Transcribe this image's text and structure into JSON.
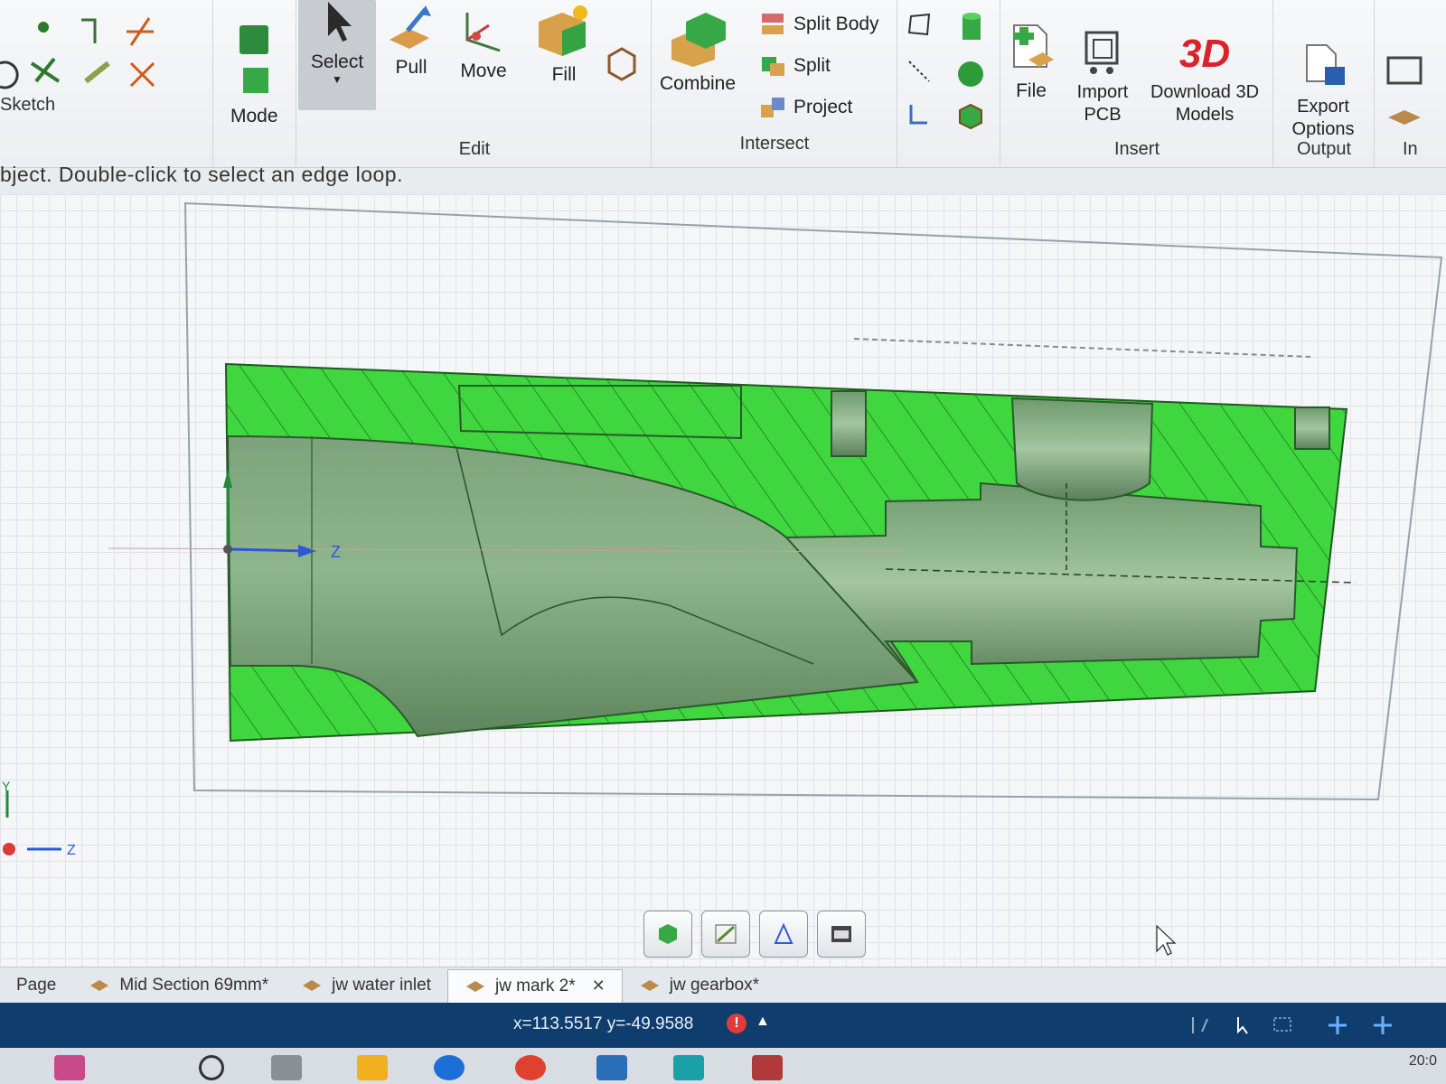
{
  "ribbon": {
    "sketch_label": "Sketch",
    "mode_label": "Mode",
    "edit": {
      "group_label": "Edit",
      "select_label": "Select",
      "pull_label": "Pull",
      "move_label": "Move",
      "fill_label": "Fill"
    },
    "intersect": {
      "group_label": "Intersect",
      "combine_label": "Combine",
      "split_body_label": "Split Body",
      "split_label": "Split",
      "project_label": "Project"
    },
    "insert": {
      "group_label": "Insert",
      "file_label": "File",
      "import_pcb_label": "Import PCB",
      "download_label": "Download 3D Models",
      "download_badge": "3D"
    },
    "output": {
      "group_label": "Output",
      "export_label": "Export Options"
    },
    "next_group_label": "In"
  },
  "hint_text": "bject. Double-click to select an edge loop.",
  "axis": {
    "z": "Z",
    "y": "Y"
  },
  "tabs": [
    {
      "label": "Page"
    },
    {
      "label": "Mid Section 69mm*"
    },
    {
      "label": "jw water inlet"
    },
    {
      "label": "jw mark 2*",
      "active": true
    },
    {
      "label": "jw gearbox*"
    }
  ],
  "status": {
    "coords": "x=113.5517  y=-49.9588",
    "warning": "!",
    "clock": "20:0"
  },
  "colors": {
    "accent_green": "#3fd63f",
    "status_bar": "#0f3e6e",
    "download_red": "#d9222a"
  }
}
